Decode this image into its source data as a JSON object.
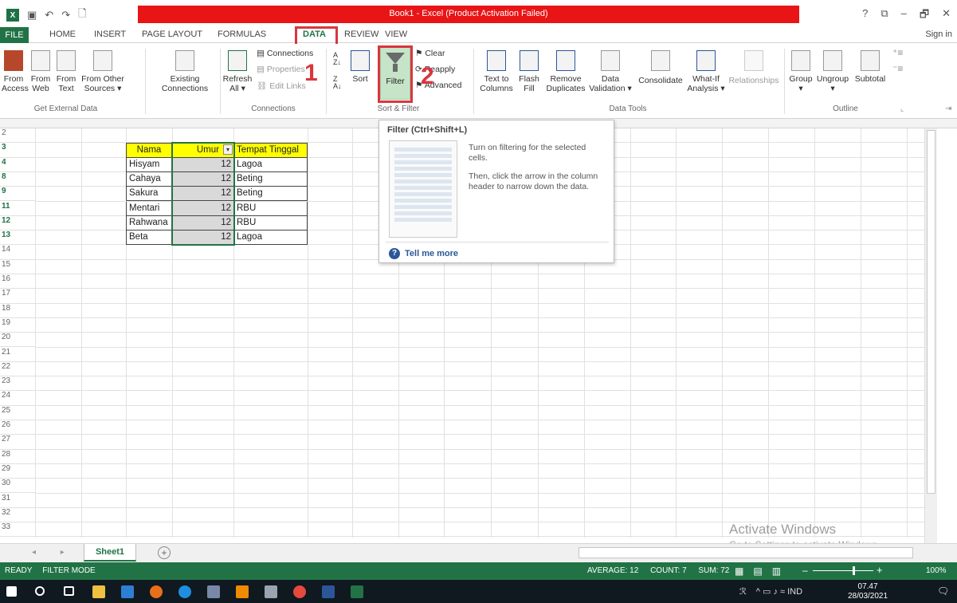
{
  "window": {
    "title": "Book1 - Excel (Product Activation Failed)",
    "help": "?",
    "restore_ribbon": "⧉",
    "minimize": "–",
    "maximize": "🗗",
    "close": "✕"
  },
  "qat": {
    "logo": "X",
    "undo": "↶",
    "redo": "↷",
    "new": "🗋"
  },
  "tabs": {
    "file": "FILE",
    "items": [
      "HOME",
      "INSERT",
      "PAGE LAYOUT",
      "FORMULAS",
      "DATA",
      "REVIEW",
      "VIEW"
    ],
    "sign_in": "Sign in"
  },
  "ribbon": {
    "get_external": {
      "from_access": "From\nAccess",
      "from_web": "From\nWeb",
      "from_text": "From\nText",
      "from_other": "From Other\nSources ▾",
      "label": "Get External Data"
    },
    "existing_connections": "Existing\nConnections",
    "connections": {
      "refresh": "Refresh\nAll ▾",
      "connections": "Connections",
      "properties": "Properties",
      "edit_links": "Edit Links",
      "label": "Connections"
    },
    "sort_filter": {
      "sort": "Sort",
      "filter": "Filter",
      "clear": "Clear",
      "reapply": "Reapply",
      "advanced": "Advanced",
      "label": "Sort & Filter"
    },
    "data_tools": {
      "text_to_columns": "Text to\nColumns",
      "flash_fill": "Flash\nFill",
      "remove_duplicates": "Remove\nDuplicates",
      "data_validation": "Data\nValidation ▾",
      "consolidate": "Consolidate",
      "what_if": "What-If\nAnalysis ▾",
      "relationships": "Relationships",
      "label": "Data Tools"
    },
    "outline": {
      "group": "Group\n▾",
      "ungroup": "Ungroup\n▾",
      "subtotal": "Subtotal",
      "label": "Outline"
    }
  },
  "annotations": {
    "one": "1",
    "two": "2"
  },
  "row_headers": [
    "2",
    "3",
    "4",
    "8",
    "9",
    "11",
    "12",
    "13",
    "14",
    "15",
    "16",
    "17",
    "18",
    "19",
    "20",
    "21",
    "22",
    "23",
    "24",
    "25",
    "26",
    "27",
    "28",
    "29",
    "30",
    "31",
    "32",
    "33"
  ],
  "table": {
    "headers": [
      "Nama",
      "Umur",
      "Tempat Tinggal"
    ],
    "filter_glyph": "▾",
    "rows": [
      [
        "Hisyam",
        "12",
        "Lagoa"
      ],
      [
        "Cahaya",
        "12",
        "Beting"
      ],
      [
        "Sakura",
        "12",
        "Beting"
      ],
      [
        "Mentari",
        "12",
        "RBU"
      ],
      [
        "Rahwana",
        "12",
        "RBU"
      ],
      [
        "Beta",
        "12",
        "Lagoa"
      ]
    ]
  },
  "tooltip": {
    "title": "Filter (Ctrl+Shift+L)",
    "line1": "Turn on filtering for the selected cells.",
    "line2": "Then, click the arrow in the column header to narrow down the data.",
    "more": "Tell me more",
    "more_icon": "?"
  },
  "watermark": {
    "line1": "Activate Windows",
    "line2": "Go to Settings to activate Windows."
  },
  "sheets": {
    "nav": "◂ ▸",
    "active": "Sheet1",
    "add": "+"
  },
  "status": {
    "ready": "READY",
    "mode": "FILTER MODE",
    "average": "AVERAGE: 12",
    "count": "COUNT: 7",
    "sum": "SUM: 72",
    "view_normal": "▦",
    "view_layout": "▤",
    "view_break": "▥",
    "zoom_minus": "–",
    "zoom_plus": "+",
    "zoom": "100%"
  },
  "taskbar": {
    "tray_people": "ℛ",
    "tray_items": "^  ▭  ♪  ≈  IND",
    "time": "07.47",
    "date": "28/03/2021",
    "notif": "🗨"
  }
}
